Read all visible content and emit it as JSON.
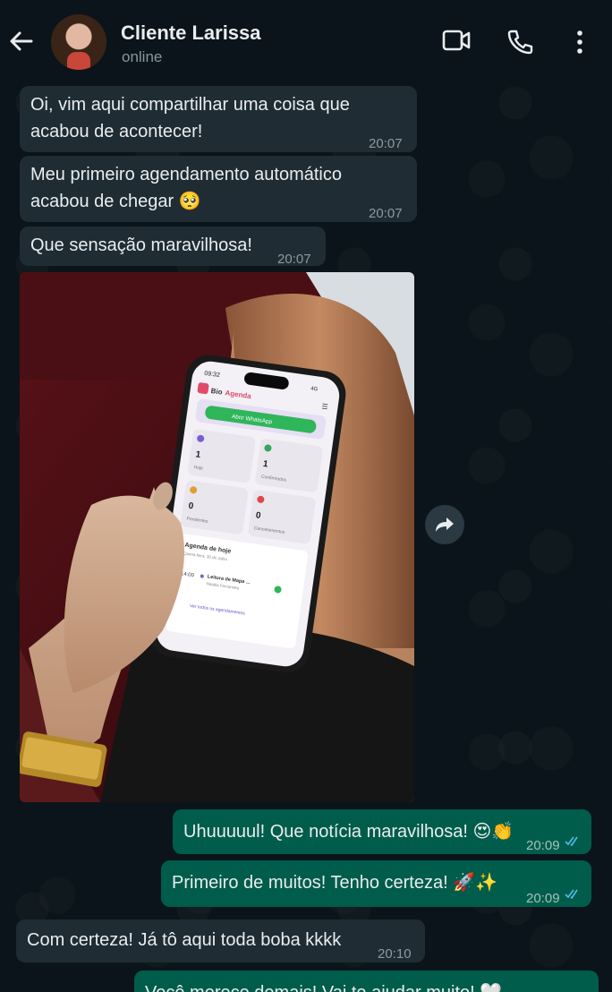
{
  "header": {
    "contact_name": "Cliente Larissa",
    "status": "online",
    "icons": [
      "back-arrow-icon",
      "video-call-icon",
      "phone-icon",
      "more-vert-icon"
    ]
  },
  "messages": [
    {
      "dir": "in",
      "lines": [
        "Oi, vim aqui compartilhar uma coisa que",
        "acabou de acontecer!"
      ],
      "time": "20:07"
    },
    {
      "dir": "in",
      "lines": [
        "Meu primeiro agendamento automático",
        "acabou de chegar 🥺"
      ],
      "time": "20:07"
    },
    {
      "dir": "in",
      "lines": [
        "Que sensação maravilhosa!"
      ],
      "time": "20:07"
    },
    {
      "dir": "out",
      "lines": [
        "Uhuuuuul! Que notícia maravilhosa! 😍👏"
      ],
      "time": "20:09"
    },
    {
      "dir": "out",
      "lines": [
        "Primeiro de muitos! Tenho certeza! 🚀✨"
      ],
      "time": "20:09"
    },
    {
      "dir": "in",
      "lines": [
        "Com certeza! Já tô aqui toda boba kkkk"
      ],
      "time": "20:10"
    },
    {
      "dir": "out",
      "lines": [
        "Você merece demais! Vai te ajudar muito! 🤍"
      ],
      "time": ""
    }
  ],
  "photo": {
    "phone_time": "09:32",
    "phone_signal": "4G",
    "app_name_a": "Bio",
    "app_name_b": "Agenda",
    "whatsapp_button": "Abrir WhatsApp",
    "stats": [
      {
        "value": "1",
        "label": "Hoje",
        "color": "#7c5cd6"
      },
      {
        "value": "1",
        "label": "Confirmados",
        "color": "#3aa55a"
      },
      {
        "value": "0",
        "label": "Pendentes",
        "color": "#e0a030"
      },
      {
        "value": "0",
        "label": "Cancelamentos",
        "color": "#e04848"
      }
    ],
    "agenda_title": "Agenda de hoje",
    "agenda_date": "Quinta-feira, 30 de Julho",
    "appt_time": "14:00",
    "appt_title": "Leitura de Mapa ...",
    "appt_name": "Natália Fernandes",
    "see_all": "Ver todos os agendamentos"
  },
  "colors": {
    "background": "#0b141a",
    "incoming_bubble": "#1f2c34",
    "outgoing_bubble": "#005c4b",
    "read_ticks": "#53bdeb"
  }
}
